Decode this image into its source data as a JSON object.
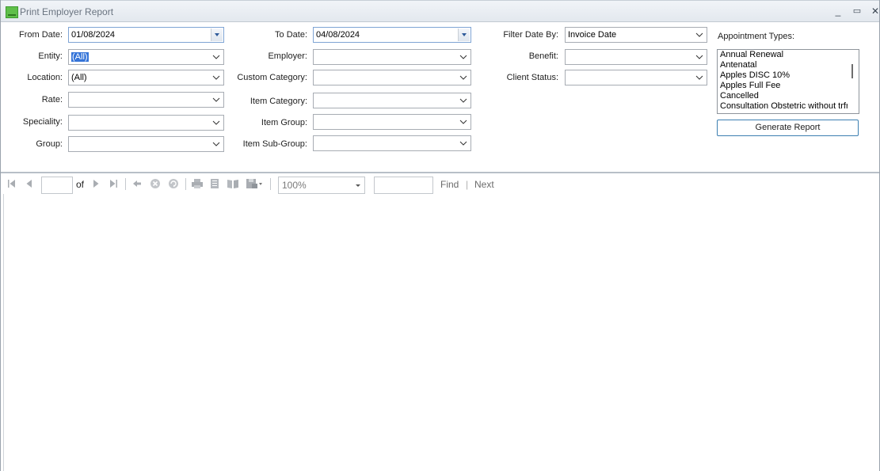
{
  "window": {
    "title": "Print Employer Report",
    "controls": {
      "minimize": "_",
      "maximize": "▭",
      "close": "✕"
    }
  },
  "form": {
    "from_date": {
      "label": "From Date:",
      "value": "01/08/2024"
    },
    "to_date": {
      "label": "To Date:",
      "value": "04/08/2024"
    },
    "filter_date_by": {
      "label": "Filter Date By:",
      "value": "Invoice Date"
    },
    "entity": {
      "label": "Entity:",
      "value": "(All)"
    },
    "employer": {
      "label": "Employer:",
      "value": ""
    },
    "benefit": {
      "label": "Benefit:",
      "value": ""
    },
    "location": {
      "label": "Location:",
      "value": "(All)"
    },
    "custom_category": {
      "label": "Custom Category:",
      "value": ""
    },
    "client_status": {
      "label": "Client Status:",
      "value": ""
    },
    "rate": {
      "label": "Rate:",
      "value": ""
    },
    "item_category": {
      "label": "Item Category:",
      "value": ""
    },
    "speciality": {
      "label": "Speciality:",
      "value": ""
    },
    "item_group": {
      "label": "Item Group:",
      "value": ""
    },
    "group": {
      "label": "Group:",
      "value": ""
    },
    "item_sub_group": {
      "label": "Item Sub-Group:",
      "value": ""
    }
  },
  "appointment_types": {
    "label": "Appointment Types:",
    "items": [
      "Annual Renewal",
      "Antenatal",
      "Apples DISC 10%",
      "Apples Full Fee",
      "Cancelled",
      "Consultation Obstetric without trfr"
    ]
  },
  "generate_button": "Generate Report",
  "viewer_toolbar": {
    "page_value": "",
    "of_label": "of",
    "zoom": "100%",
    "find_value": "",
    "find_label": "Find",
    "separator": "|",
    "next_label": "Next"
  },
  "colors": {
    "accent_border": "#3c7fb1",
    "selection": "#3574d8",
    "app_icon": "#5fbf4a"
  }
}
